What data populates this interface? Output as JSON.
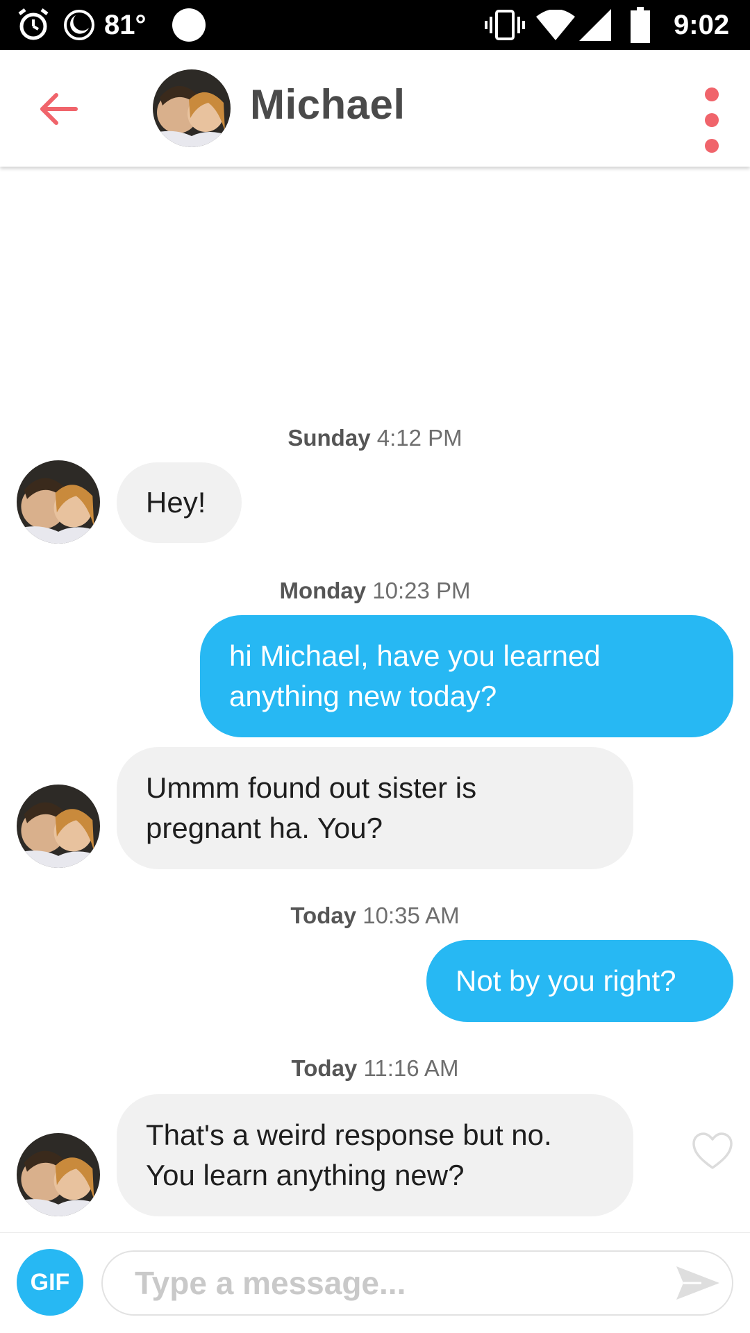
{
  "status_bar": {
    "temperature": "81°",
    "time": "9:02",
    "icons": [
      "alarm-icon",
      "do-not-disturb-icon",
      "weather-dot-icon",
      "vibrate-icon",
      "wifi-icon",
      "signal-icon",
      "battery-icon"
    ]
  },
  "header": {
    "title": "Michael",
    "back_icon": "arrow-left-icon",
    "menu_icon": "more-vertical-icon"
  },
  "messages": [
    {
      "timestamp_day": "Sunday",
      "timestamp_time": "4:12 PM"
    },
    {
      "from": "them",
      "text": "Hey!"
    },
    {
      "timestamp_day": "Monday",
      "timestamp_time": "10:23 PM"
    },
    {
      "from": "me",
      "line1": "hi Michael, have you learned",
      "line2": "anything new today?"
    },
    {
      "from": "them",
      "line1": "Ummm found out sister is",
      "line2": "pregnant ha. You?"
    },
    {
      "timestamp_day": "Today",
      "timestamp_time": "10:35 AM"
    },
    {
      "from": "me",
      "text": "Not by you right?"
    },
    {
      "timestamp_day": "Today",
      "timestamp_time": "11:16 AM"
    },
    {
      "from": "them",
      "line1": "That's a weird response but no.",
      "line2": "You learn anything new?"
    }
  ],
  "composer": {
    "gif_label": "GIF",
    "placeholder": "Type a message...",
    "send_icon": "send-icon"
  },
  "colors": {
    "accent": "#f0646b",
    "outgoing_bubble": "#27b8f3",
    "incoming_bubble": "#f1f1f1"
  }
}
